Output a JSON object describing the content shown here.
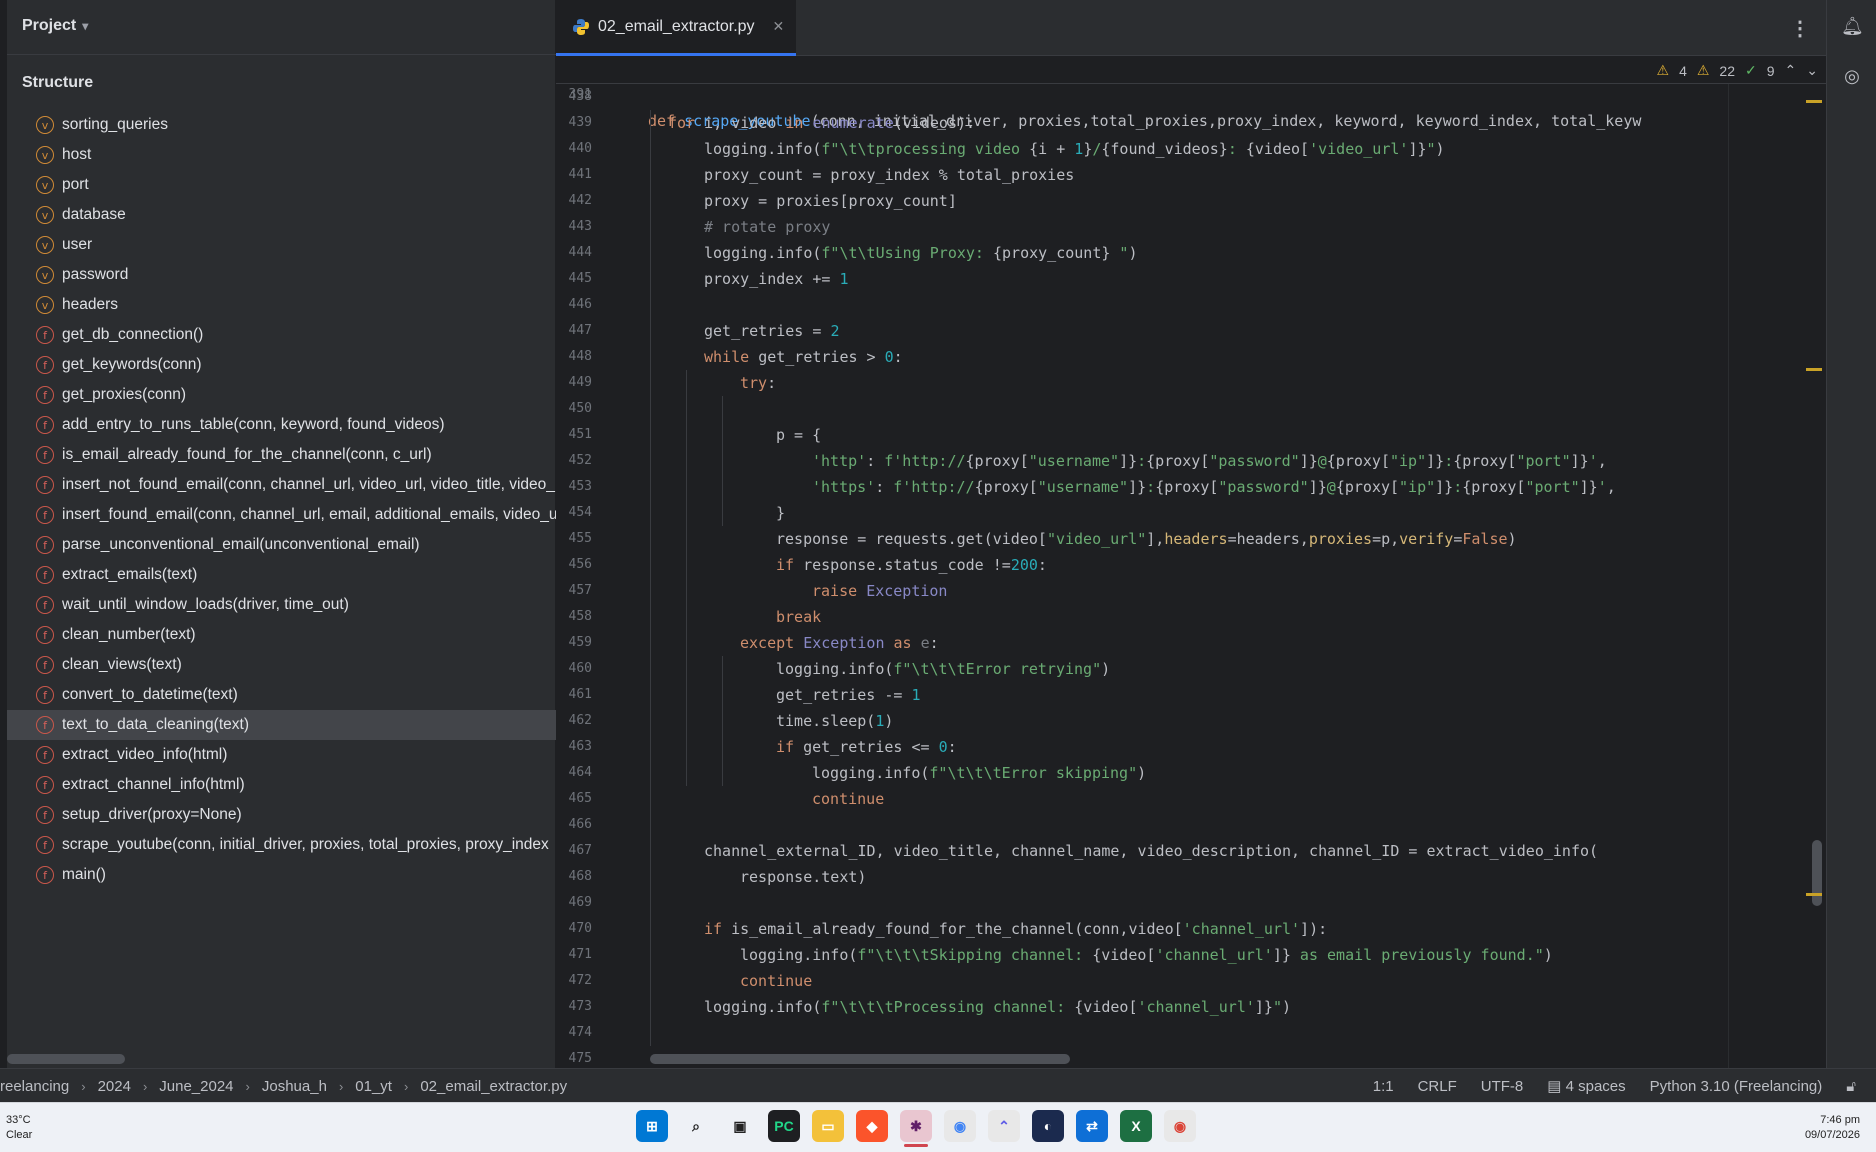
{
  "window": {
    "project_label": "Project",
    "structure_title": "Structure",
    "tab_label": "02_email_extractor.py",
    "sticky_line_number": "391",
    "sticky_code": "def scrape_youtube(conn, initial_driver, proxies,total_proxies,proxy_index, keyword, keyword_index, total_keyw",
    "inspection": {
      "warnings": "4",
      "weak_warnings": "22",
      "ok": "9"
    }
  },
  "structure": [
    {
      "kind": "v",
      "label": "sorting_queries"
    },
    {
      "kind": "v",
      "label": "host"
    },
    {
      "kind": "v",
      "label": "port"
    },
    {
      "kind": "v",
      "label": "database"
    },
    {
      "kind": "v",
      "label": "user"
    },
    {
      "kind": "v",
      "label": "password"
    },
    {
      "kind": "v",
      "label": "headers"
    },
    {
      "kind": "f",
      "label": "get_db_connection()"
    },
    {
      "kind": "f",
      "label": "get_keywords(conn)"
    },
    {
      "kind": "f",
      "label": "get_proxies(conn)"
    },
    {
      "kind": "f",
      "label": "add_entry_to_runs_table(conn, keyword, found_videos)"
    },
    {
      "kind": "f",
      "label": "is_email_already_found_for_the_channel(conn, c_url)"
    },
    {
      "kind": "f",
      "label": "insert_not_found_email(conn, channel_url, video_url, video_title, video_"
    },
    {
      "kind": "f",
      "label": "insert_found_email(conn, channel_url, email, additional_emails, video_u"
    },
    {
      "kind": "f",
      "label": "parse_unconventional_email(unconventional_email)"
    },
    {
      "kind": "f",
      "label": "extract_emails(text)"
    },
    {
      "kind": "f",
      "label": "wait_until_window_loads(driver, time_out)"
    },
    {
      "kind": "f",
      "label": "clean_number(text)"
    },
    {
      "kind": "f",
      "label": "clean_views(text)"
    },
    {
      "kind": "f",
      "label": "convert_to_datetime(text)"
    },
    {
      "kind": "f",
      "label": "text_to_data_cleaning(text)",
      "selected": true
    },
    {
      "kind": "f",
      "label": "extract_video_info(html)"
    },
    {
      "kind": "f",
      "label": "extract_channel_info(html)"
    },
    {
      "kind": "f",
      "label": "setup_driver(proxy=None)"
    },
    {
      "kind": "f",
      "label": "scrape_youtube(conn, initial_driver, proxies, total_proxies, proxy_index"
    },
    {
      "kind": "f",
      "label": "main()"
    }
  ],
  "code_lines": [
    {
      "n": "438",
      "indent": 0,
      "tokens": []
    },
    {
      "n": "439",
      "indent": 1,
      "tokens": [
        [
          "kw",
          "for "
        ],
        [
          "",
          "i, video "
        ],
        [
          "kw",
          "in "
        ],
        [
          "bi",
          "enumerate"
        ],
        [
          "",
          "(videos):"
        ]
      ]
    },
    {
      "n": "440",
      "indent": 2,
      "tokens": [
        [
          "",
          "logging.info("
        ],
        [
          "st",
          "f\"\\t\\tprocessing video "
        ],
        [
          "",
          "{i + "
        ],
        [
          "nm",
          "1"
        ],
        [
          "",
          "}"
        ],
        [
          "st",
          "/"
        ],
        [
          "",
          "{found_videos}"
        ],
        [
          "st",
          ": "
        ],
        [
          "",
          "{video["
        ],
        [
          "st",
          "'video_url'"
        ],
        [
          "",
          "]}"
        ],
        [
          "st",
          "\""
        ],
        [
          "",
          ")"
        ]
      ]
    },
    {
      "n": "441",
      "indent": 2,
      "tokens": [
        [
          "",
          "proxy_count = proxy_index % total_proxies"
        ]
      ]
    },
    {
      "n": "442",
      "indent": 2,
      "tokens": [
        [
          "",
          "proxy = proxies[proxy_count]"
        ]
      ]
    },
    {
      "n": "443",
      "indent": 2,
      "tokens": [
        [
          "cm",
          "# rotate proxy"
        ]
      ]
    },
    {
      "n": "444",
      "indent": 2,
      "tokens": [
        [
          "",
          "logging.info("
        ],
        [
          "st",
          "f\"\\t\\tUsing Proxy: "
        ],
        [
          "",
          "{proxy_count}"
        ],
        [
          "st",
          " \""
        ],
        [
          "",
          ")"
        ]
      ]
    },
    {
      "n": "445",
      "indent": 2,
      "tokens": [
        [
          "",
          "proxy_index += "
        ],
        [
          "nm",
          "1"
        ]
      ]
    },
    {
      "n": "446",
      "indent": 0,
      "tokens": []
    },
    {
      "n": "447",
      "indent": 2,
      "tokens": [
        [
          "",
          "get_retries = "
        ],
        [
          "nm",
          "2"
        ]
      ]
    },
    {
      "n": "448",
      "indent": 2,
      "tokens": [
        [
          "kw",
          "while "
        ],
        [
          "",
          "get_retries > "
        ],
        [
          "nm",
          "0"
        ],
        [
          "",
          ":"
        ]
      ]
    },
    {
      "n": "449",
      "indent": 3,
      "tokens": [
        [
          "kw",
          "try"
        ],
        [
          "",
          ":"
        ]
      ]
    },
    {
      "n": "450",
      "indent": 0,
      "tokens": []
    },
    {
      "n": "451",
      "indent": 4,
      "tokens": [
        [
          "",
          "p = {"
        ]
      ]
    },
    {
      "n": "452",
      "indent": 5,
      "tokens": [
        [
          "st",
          "'http'"
        ],
        [
          "",
          ": "
        ],
        [
          "st",
          "f'http://"
        ],
        [
          "",
          "{proxy["
        ],
        [
          "st",
          "\"username\""
        ],
        [
          "",
          "]}"
        ],
        [
          "st",
          ":"
        ],
        [
          "",
          "{proxy["
        ],
        [
          "st",
          "\"password\""
        ],
        [
          "",
          "]}"
        ],
        [
          "st",
          "@"
        ],
        [
          "",
          "{proxy["
        ],
        [
          "st",
          "\"ip\""
        ],
        [
          "",
          "]}"
        ],
        [
          "st",
          ":"
        ],
        [
          "",
          "{proxy["
        ],
        [
          "st",
          "\"port\""
        ],
        [
          "",
          "]}"
        ],
        [
          "st",
          "'"
        ],
        [
          "",
          ","
        ]
      ]
    },
    {
      "n": "453",
      "indent": 5,
      "tokens": [
        [
          "st",
          "'https'"
        ],
        [
          "",
          ": "
        ],
        [
          "st",
          "f'http://"
        ],
        [
          "",
          "{proxy["
        ],
        [
          "st",
          "\"username\""
        ],
        [
          "",
          "]}"
        ],
        [
          "st",
          ":"
        ],
        [
          "",
          "{proxy["
        ],
        [
          "st",
          "\"password\""
        ],
        [
          "",
          "]}"
        ],
        [
          "st",
          "@"
        ],
        [
          "",
          "{proxy["
        ],
        [
          "st",
          "\"ip\""
        ],
        [
          "",
          "]}"
        ],
        [
          "st",
          ":"
        ],
        [
          "",
          "{proxy["
        ],
        [
          "st",
          "\"port\""
        ],
        [
          "",
          "]}"
        ],
        [
          "st",
          "'"
        ],
        [
          "",
          ","
        ]
      ]
    },
    {
      "n": "454",
      "indent": 4,
      "tokens": [
        [
          "",
          "}"
        ]
      ]
    },
    {
      "n": "455",
      "indent": 4,
      "tokens": [
        [
          "",
          "response = requests.get(video["
        ],
        [
          "st",
          "\"video_url\""
        ],
        [
          "",
          "],"
        ],
        [
          "pm",
          "headers"
        ],
        [
          "",
          "=headers,"
        ],
        [
          "pm",
          "proxies"
        ],
        [
          "",
          "=p,"
        ],
        [
          "pm",
          "verify"
        ],
        [
          "",
          "="
        ],
        [
          "kw",
          "False"
        ],
        [
          "",
          ")"
        ]
      ]
    },
    {
      "n": "456",
      "indent": 4,
      "tokens": [
        [
          "kw",
          "if "
        ],
        [
          "",
          "response.status_code !="
        ],
        [
          "nm",
          "200"
        ],
        [
          "",
          ":"
        ]
      ]
    },
    {
      "n": "457",
      "indent": 5,
      "tokens": [
        [
          "kw",
          "raise "
        ],
        [
          "bi",
          "Exception"
        ]
      ]
    },
    {
      "n": "458",
      "indent": 4,
      "tokens": [
        [
          "kw",
          "break"
        ]
      ]
    },
    {
      "n": "459",
      "indent": 3,
      "tokens": [
        [
          "kw",
          "except "
        ],
        [
          "bi",
          "Exception "
        ],
        [
          "kw",
          "as "
        ],
        [
          "cm",
          "e"
        ],
        [
          "",
          ":"
        ]
      ]
    },
    {
      "n": "460",
      "indent": 4,
      "tokens": [
        [
          "",
          "logging.info("
        ],
        [
          "st",
          "f\"\\t\\t\\tError retrying\""
        ],
        [
          "",
          ")"
        ]
      ]
    },
    {
      "n": "461",
      "indent": 4,
      "tokens": [
        [
          "",
          "get_retries -= "
        ],
        [
          "nm",
          "1"
        ]
      ]
    },
    {
      "n": "462",
      "indent": 4,
      "tokens": [
        [
          "",
          "time.sleep("
        ],
        [
          "nm",
          "1"
        ],
        [
          "",
          ")"
        ]
      ]
    },
    {
      "n": "463",
      "indent": 4,
      "tokens": [
        [
          "kw",
          "if "
        ],
        [
          "",
          "get_retries <= "
        ],
        [
          "nm",
          "0"
        ],
        [
          "",
          ":"
        ]
      ]
    },
    {
      "n": "464",
      "indent": 5,
      "tokens": [
        [
          "",
          "logging.info("
        ],
        [
          "st",
          "f\"\\t\\t\\tError skipping\""
        ],
        [
          "",
          ")"
        ]
      ]
    },
    {
      "n": "465",
      "indent": 5,
      "tokens": [
        [
          "kw",
          "continue"
        ]
      ]
    },
    {
      "n": "466",
      "indent": 0,
      "tokens": []
    },
    {
      "n": "467",
      "indent": 2,
      "tokens": [
        [
          "",
          "channel_external_ID, video_title, channel_name, video_description, channel_ID = extract_video_info("
        ]
      ]
    },
    {
      "n": "468",
      "indent": 3,
      "tokens": [
        [
          "",
          "response.text)"
        ]
      ]
    },
    {
      "n": "469",
      "indent": 0,
      "tokens": []
    },
    {
      "n": "470",
      "indent": 2,
      "tokens": [
        [
          "kw",
          "if "
        ],
        [
          "",
          "is_email_already_found_for_the_channel(conn,video["
        ],
        [
          "st",
          "'channel_url'"
        ],
        [
          "",
          "]):"
        ]
      ]
    },
    {
      "n": "471",
      "indent": 3,
      "tokens": [
        [
          "",
          "logging.info("
        ],
        [
          "st",
          "f\"\\t\\t\\tSkipping channel: "
        ],
        [
          "",
          "{video["
        ],
        [
          "st",
          "'channel_url'"
        ],
        [
          "",
          "]}"
        ],
        [
          "st",
          " as email previously found.\""
        ],
        [
          "",
          ")"
        ]
      ]
    },
    {
      "n": "472",
      "indent": 3,
      "tokens": [
        [
          "kw",
          "continue"
        ]
      ]
    },
    {
      "n": "473",
      "indent": 2,
      "tokens": [
        [
          "",
          "logging.info("
        ],
        [
          "st",
          "f\"\\t\\t\\tProcessing channel: "
        ],
        [
          "",
          "{video["
        ],
        [
          "st",
          "'channel_url'"
        ],
        [
          "",
          "]}"
        ],
        [
          "st",
          "\""
        ],
        [
          "",
          ")"
        ]
      ]
    },
    {
      "n": "474",
      "indent": 0,
      "tokens": []
    },
    {
      "n": "475",
      "indent": 0,
      "tokens": []
    }
  ],
  "status": {
    "crumbs": [
      "reelancing",
      "2024",
      "June_2024",
      "Joshua_h",
      "01_yt",
      "02_email_extractor.py"
    ],
    "position": "1:1",
    "line_sep": "CRLF",
    "encoding": "UTF-8",
    "indent": "4 spaces",
    "interpreter": "Python 3.10 (Freelancing)"
  },
  "taskbar": {
    "temp": "33°C",
    "weather": "Clear",
    "time": "7:46 pm",
    "date": "09/07/2026"
  },
  "colors": {
    "accent": "#3574f0",
    "selection": "#43454a"
  }
}
